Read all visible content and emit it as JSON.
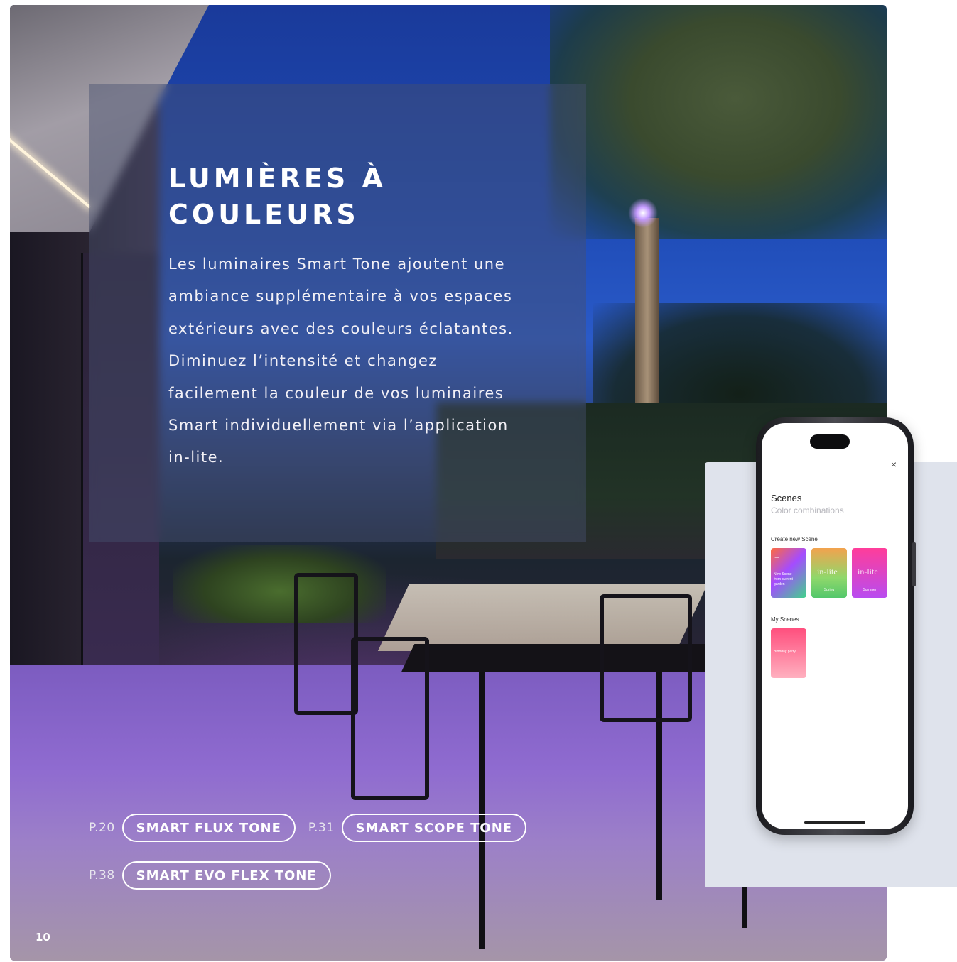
{
  "headline": {
    "line1": "LUMIÈRES À",
    "line2": "COULEURS"
  },
  "body": "Les luminaires Smart Tone ajoutent une ambiance supplémentaire à vos espaces extérieurs avec des couleurs éclatantes. Diminuez l’intensité et changez facilement la couleur de vos luminaires Smart individuellement via l’application in-lite.",
  "products": [
    {
      "page": "P.20",
      "name": "SMART FLUX TONE"
    },
    {
      "page": "P.31",
      "name": "SMART SCOPE TONE"
    },
    {
      "page": "P.38",
      "name": "SMART EVO FLEX TONE"
    }
  ],
  "page_number": "10",
  "phone_app": {
    "close_icon": "close-icon",
    "close_glyph": "×",
    "title": "Scenes",
    "subtitle": "Color combinations",
    "create_label": "Create new Scene",
    "create_tiles": [
      {
        "label": "New Scene from current garden",
        "plus": "+",
        "gradient": "linear-gradient(135deg,#ff6a3d 0%,#a44cff 45%,#3fd48a 100%)"
      },
      {
        "brand": "in-lite",
        "label": "Spring",
        "gradient": "linear-gradient(180deg,#f2a24e 0%,#8fd86b 60%,#53c76b 100%)"
      },
      {
        "brand": "in-lite",
        "label": "Summer",
        "gradient": "linear-gradient(180deg,#ff3d9a 0%,#b94cf0 100%)"
      }
    ],
    "my_scenes_label": "My Scenes",
    "my_tiles": [
      {
        "label": "Birthday party"
      }
    ]
  },
  "colors": {
    "side_panel": "#dfe3ec",
    "text_light": "#ffffff",
    "card_overlay": "rgba(70,80,110,0.45)"
  }
}
